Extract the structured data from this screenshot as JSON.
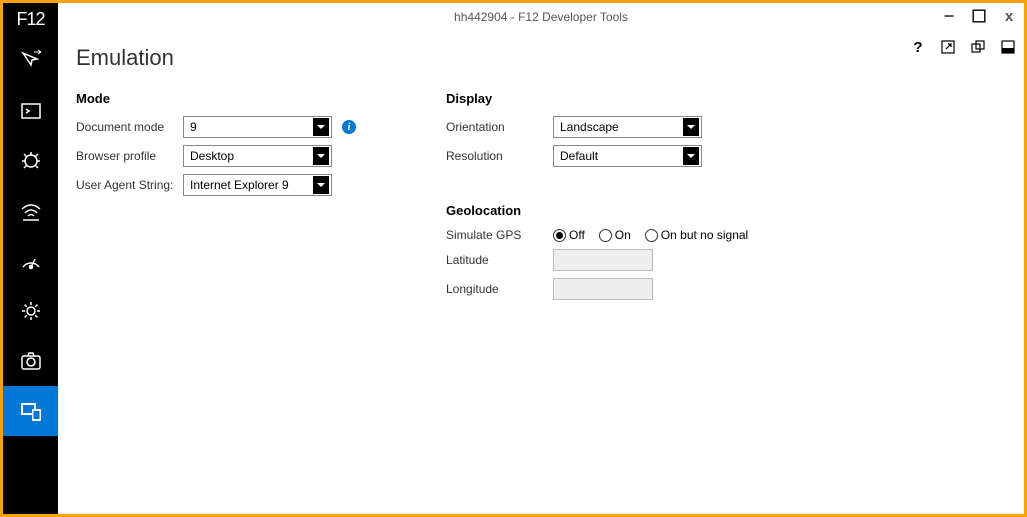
{
  "window": {
    "title": "hh442904 - F12 Developer Tools",
    "logo": "F12"
  },
  "page": {
    "title": "Emulation"
  },
  "sections": {
    "mode": {
      "title": "Mode",
      "fields": {
        "document_mode": {
          "label": "Document mode",
          "value": "9"
        },
        "browser_profile": {
          "label": "Browser profile",
          "value": "Desktop"
        },
        "user_agent": {
          "label": "User Agent String:",
          "value": "Internet Explorer 9"
        }
      }
    },
    "display": {
      "title": "Display",
      "fields": {
        "orientation": {
          "label": "Orientation",
          "value": "Landscape"
        },
        "resolution": {
          "label": "Resolution",
          "value": "Default"
        }
      }
    },
    "geolocation": {
      "title": "Geolocation",
      "simulate_gps": {
        "label": "Simulate GPS",
        "options": {
          "off": "Off",
          "on": "On",
          "on_no_signal": "On but no signal"
        },
        "selected": "off"
      },
      "latitude": {
        "label": "Latitude",
        "value": ""
      },
      "longitude": {
        "label": "Longitude",
        "value": ""
      }
    }
  },
  "titlebar_controls": {
    "minimize": "−",
    "maximize": "",
    "close": "x"
  },
  "toolbar": {
    "help": "?"
  }
}
